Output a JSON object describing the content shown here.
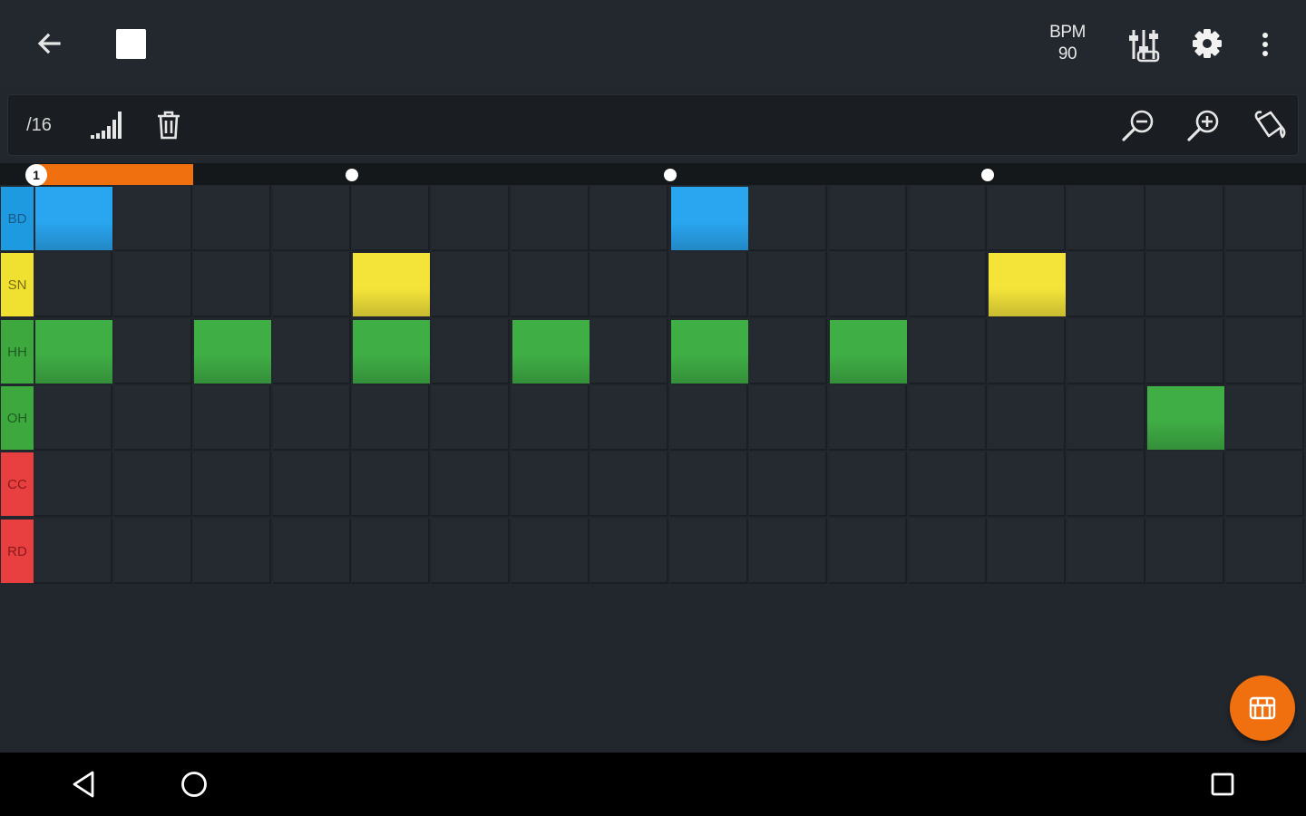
{
  "toolbar": {
    "bpm_label": "BPM",
    "bpm_value": "90",
    "steps_label": "/16"
  },
  "timeline": {
    "playhead_label": "1",
    "playhead_step": 1,
    "highlighted_steps": 2,
    "beat_markers_at_steps": [
      5,
      9,
      13
    ]
  },
  "grid": {
    "steps": 16,
    "tracks": [
      {
        "label": "BD",
        "label_color": "#1e9ae0",
        "pad_color": "#2aa6f0",
        "text_color": "#1a5a86",
        "active_steps": [
          1,
          9
        ]
      },
      {
        "label": "SN",
        "label_color": "#f0e030",
        "pad_color": "#f4e43a",
        "text_color": "#7a6d10",
        "active_steps": [
          5,
          13
        ]
      },
      {
        "label": "HH",
        "label_color": "#3da83d",
        "pad_color": "#3fae45",
        "text_color": "#1f5e22",
        "active_steps": [
          1,
          3,
          5,
          7,
          9,
          11
        ]
      },
      {
        "label": "OH",
        "label_color": "#3da83d",
        "pad_color": "#3fae45",
        "text_color": "#1f5e22",
        "active_steps": [
          15
        ]
      },
      {
        "label": "CC",
        "label_color": "#e84040",
        "pad_color": "#e84040",
        "text_color": "#8a1a1a",
        "active_steps": []
      },
      {
        "label": "RD",
        "label_color": "#e84040",
        "pad_color": "#e84040",
        "text_color": "#8a1a1a",
        "active_steps": []
      }
    ]
  },
  "colors": {
    "accent": "#f07010",
    "background": "#22272d",
    "cell_empty": "#252a30"
  },
  "icons": {
    "back": "arrow-left-icon",
    "stop": "stop-square-icon",
    "mixer": "mixer-sliders-icon",
    "settings": "gear-icon",
    "more": "more-vertical-icon",
    "velocity": "signal-bars-icon",
    "clear": "trash-icon",
    "zoom_out": "zoom-out-icon",
    "zoom_in": "zoom-in-icon",
    "paint": "paint-bucket-icon",
    "fab": "drum-kit-icon",
    "nav_back": "nav-back-icon",
    "nav_home": "nav-home-icon",
    "nav_recents": "nav-recents-icon"
  }
}
